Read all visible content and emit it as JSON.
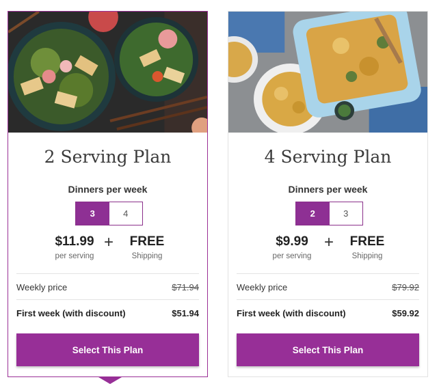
{
  "accent_color": "#972f97",
  "plans": [
    {
      "title": "2 Serving Plan",
      "photo": "salad-bowls-photo",
      "dinners_label": "Dinners per week",
      "options": [
        "3",
        "4"
      ],
      "selected_option": "3",
      "price": "$11.99",
      "price_caption": "per serving",
      "plus": "+",
      "shipping": "FREE",
      "shipping_caption": "Shipping",
      "weekly_label": "Weekly price",
      "weekly_value": "$71.94",
      "first_week_label": "First week (with discount)",
      "first_week_value": "$51.94",
      "button_label": "Select This Plan",
      "selected": true
    },
    {
      "title": "4 Serving Plan",
      "photo": "pasta-casserole-photo",
      "dinners_label": "Dinners per week",
      "options": [
        "2",
        "3"
      ],
      "selected_option": "2",
      "price": "$9.99",
      "price_caption": "per serving",
      "plus": "+",
      "shipping": "FREE",
      "shipping_caption": "Shipping",
      "weekly_label": "Weekly price",
      "weekly_value": "$79.92",
      "first_week_label": "First week (with discount)",
      "first_week_value": "$59.92",
      "button_label": "Select This Plan",
      "selected": false
    }
  ]
}
